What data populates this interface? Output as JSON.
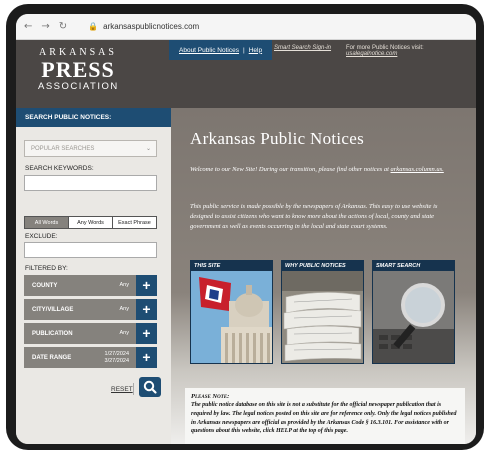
{
  "browser": {
    "back_icon": "back-arrow-icon",
    "forward_icon": "forward-arrow-icon",
    "reload_icon": "reload-icon",
    "url": "arkansaspublicnotices.com"
  },
  "header": {
    "logo": {
      "line1": "ARKANSAS",
      "line2": "PRESS",
      "line3": "ASSOCIATION"
    },
    "nav_about": "About Public Notices",
    "nav_sep": "|",
    "nav_help": "Help",
    "smart_signin": "Smart Search Sign-in",
    "more_prefix": "For more Public Notices visit:",
    "more_link": "usalegalnotice.com"
  },
  "sidebar": {
    "title": "SEARCH PUBLIC NOTICES:",
    "popular": "POPULAR SEARCHES",
    "keywords_label": "SEARCH KEYWORDS:",
    "keywords_value": "",
    "match_modes": [
      "All Words",
      "Any Words",
      "Exact Phrase"
    ],
    "exclude_label": "EXCLUDE:",
    "exclude_value": "",
    "filtered_label": "FILTERED BY:",
    "filters": [
      {
        "label": "COUNTY",
        "value": "Any"
      },
      {
        "label": "CITY/VILLAGE",
        "value": "Any"
      },
      {
        "label": "PUBLICATION",
        "value": "Any"
      },
      {
        "label": "DATE RANGE",
        "value_from": "1/27/2024",
        "value_to": "3/27/2024"
      }
    ],
    "reset": "RESET"
  },
  "main": {
    "title": "Arkansas Public Notices",
    "welcome": "Welcome to our New Site! During our transition, please find other notices at",
    "welcome_link": "arkansas.column.us.",
    "about": "This public service is made possible by the newspapers of Arkansas. This easy to use website is designed to assist citizens who want to know more about the actions of local, county and state government as well as events occurring in the local and state court systems.",
    "cards": [
      {
        "title": "THIS SITE"
      },
      {
        "title": "WHY PUBLIC NOTICES"
      },
      {
        "title": "SMART SEARCH"
      }
    ],
    "note_heading": "Please Note:",
    "note_body": "The public notice database on this site is not a substitute for the official newspaper publication that is required by law. The legal notices posted on this site are for reference only. Only the legal notices published in Arkansas newspapers are official as provided by the Arkansas Code § 16.3.101. For assistance with or questions about this website, click HELP at the top of this page."
  },
  "colors": {
    "navy": "#1e4d73",
    "header_bg": "#4b4745",
    "filter_gray": "#85827d",
    "main_bg": "#7d7670"
  }
}
